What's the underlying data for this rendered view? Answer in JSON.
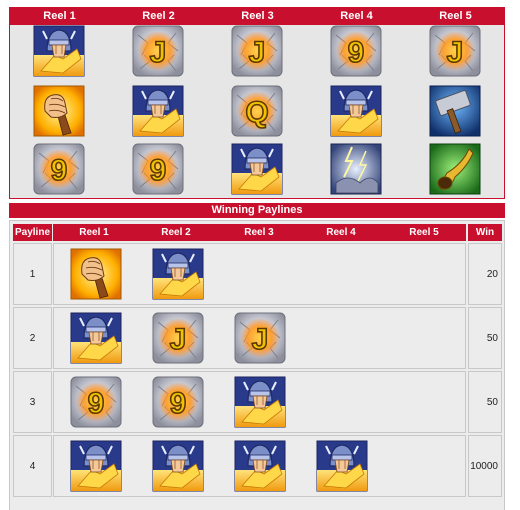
{
  "reel_grid": {
    "headers": [
      "Reel 1",
      "Reel 2",
      "Reel 3",
      "Reel 4",
      "Reel 5"
    ],
    "rows": [
      [
        "warrior",
        "J",
        "J",
        "9",
        "J"
      ],
      [
        "fist",
        "warrior",
        "Q",
        "warrior",
        "hammer"
      ],
      [
        "9",
        "9",
        "warrior",
        "storm",
        "horn"
      ]
    ]
  },
  "paylines": {
    "title": "Winning Paylines",
    "headers": {
      "payline": "Payline",
      "reels": [
        "Reel 1",
        "Reel 2",
        "Reel 3",
        "Reel 4",
        "Reel 5"
      ],
      "win": "Win"
    },
    "rows": [
      {
        "payline": "1",
        "symbols": [
          "fist",
          "warrior"
        ],
        "win": "20"
      },
      {
        "payline": "2",
        "symbols": [
          "warrior",
          "J",
          "J"
        ],
        "win": "50"
      },
      {
        "payline": "3",
        "symbols": [
          "9",
          "9",
          "warrior"
        ],
        "win": "50"
      },
      {
        "payline": "4",
        "symbols": [
          "warrior",
          "warrior",
          "warrior",
          "warrior"
        ],
        "win": "10000"
      }
    ]
  },
  "colors": {
    "header_red": "#c8102e",
    "panel_gray": "#ececec",
    "letter_gold": "#f2c200"
  }
}
